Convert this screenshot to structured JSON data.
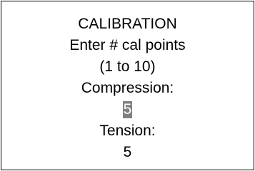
{
  "screen": {
    "title": "CALIBRATION",
    "prompt": "Enter # cal points",
    "range": "(1 to 10)",
    "compression": {
      "label": "Compression:",
      "value": "5"
    },
    "tension": {
      "label": "Tension:",
      "value": "5"
    },
    "colors": {
      "border": "#000000",
      "highlight_bg": "#808080",
      "highlight_text": "#ffffff"
    }
  }
}
